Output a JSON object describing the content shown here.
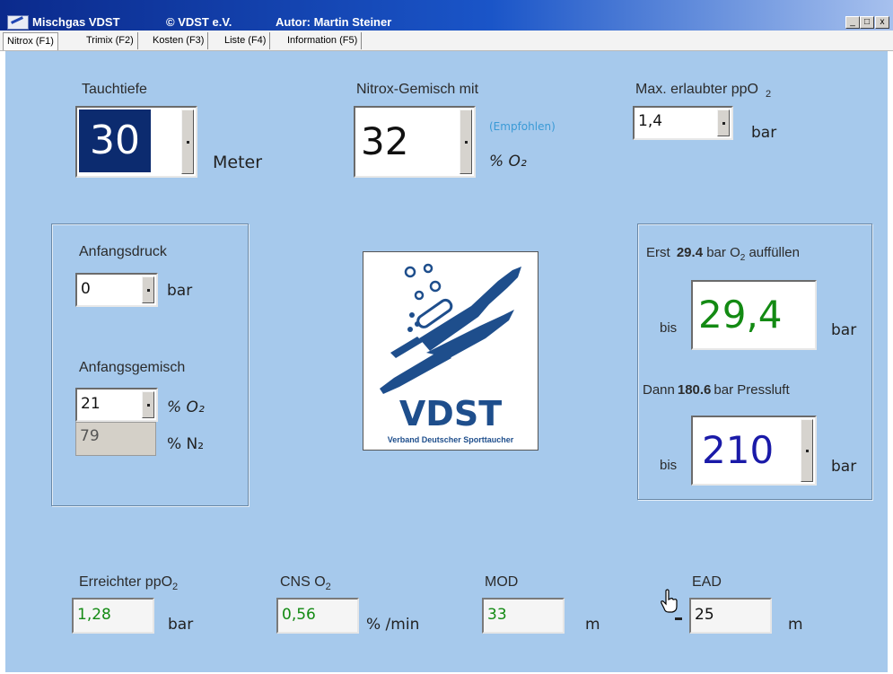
{
  "window": {
    "app_title": "Mischgas VDST",
    "copyright": "© VDST e.V.",
    "author": "Autor: Martin Steiner",
    "controls": {
      "minimize": "_",
      "maximize": "□",
      "close": "x"
    }
  },
  "tabs": [
    {
      "label": "Nitrox (F1)",
      "active": true
    },
    {
      "label": "Trimix (F2)"
    },
    {
      "label": "Kosten (F3)"
    },
    {
      "label": "Liste (F4)"
    },
    {
      "label": "Information (F5)"
    }
  ],
  "top": {
    "depth_label": "Tauchtiefe",
    "depth_value": "30",
    "depth_unit": "Meter",
    "nitrox_label": "Nitrox-Gemisch mit",
    "nitrox_value": "32",
    "nitrox_recommended": "(Empfohlen)",
    "nitrox_unit": "% O₂",
    "ppo2_label": "Max. erlaubter ppO",
    "ppo2_label_sub": "2",
    "ppo2_value": "1,4",
    "ppo2_unit": "bar"
  },
  "initial": {
    "pressure_label": "Anfangsdruck",
    "pressure_value": "0",
    "pressure_unit": "bar",
    "mix_label": "Anfangsgemisch",
    "o2_value": "21",
    "o2_unit": "% O₂",
    "n2_value": "79",
    "n2_unit": "% N₂"
  },
  "logo": {
    "text": "VDST",
    "caption": "Verband Deutscher Sporttaucher"
  },
  "fill": {
    "first_prefix": "Erst",
    "first_amount": "29.4",
    "first_mid": "bar O",
    "first_sub": "2",
    "first_suffix": " auffüllen",
    "bis_label": "bis",
    "bis1_value": "29,4",
    "bar_unit": "bar",
    "then_prefix": "Dann",
    "then_amount": "180.6",
    "then_suffix": "bar Pressluft",
    "bis2_value": "210"
  },
  "results": {
    "ppo2_label": "Erreichter ppO",
    "ppo2_sub": "2",
    "ppo2_value": "1,28",
    "ppo2_unit": "bar",
    "cns_label": "CNS O",
    "cns_sub": "2",
    "cns_value": "0,56",
    "cns_unit": "% /min",
    "mod_label": "MOD",
    "mod_value": "33",
    "mod_unit": "m",
    "ead_label": "EAD",
    "ead_value": "25",
    "ead_unit": "m"
  },
  "colors": {
    "panel": "#a6c9ec",
    "green_value": "#138a13",
    "blue_value": "#1a1aa8",
    "recommended": "#3a9ad6",
    "selection": "#0c2b6f",
    "logo_blue": "#1e4e8c"
  }
}
